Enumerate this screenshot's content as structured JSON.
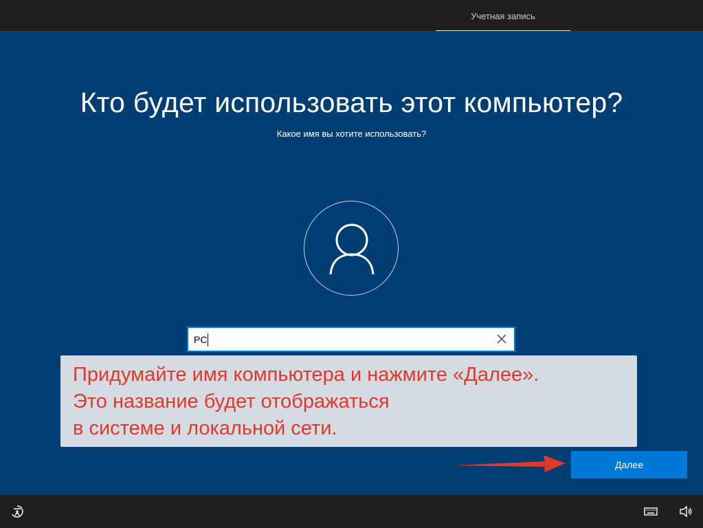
{
  "header": {
    "steps": [
      {
        "label": "Учетная запись",
        "active": true
      }
    ]
  },
  "main": {
    "title": "Кто будет использовать этот компьютер?",
    "subtitle": "Какое имя вы хотите использовать?",
    "avatar_icon": "user-icon",
    "name_input": {
      "value": "PC"
    },
    "clear_icon": "close-icon",
    "annotation": {
      "lines": [
        "Придумайте имя компьютера и нажмите «Далее».",
        "Это название будет отображаться",
        "в системе и локальной сети."
      ],
      "color": "#e0392b"
    },
    "next_button_label": "Далее"
  },
  "footer": {
    "left_icon": "ease-of-access-icon",
    "right_icons": [
      "keyboard-icon",
      "volume-icon"
    ]
  },
  "colors": {
    "background": "#013e73",
    "bar": "#1f1f1f",
    "accent": "#0078d7",
    "annotation_bg": "#d4dbe3",
    "arrow": "#e0392b"
  }
}
